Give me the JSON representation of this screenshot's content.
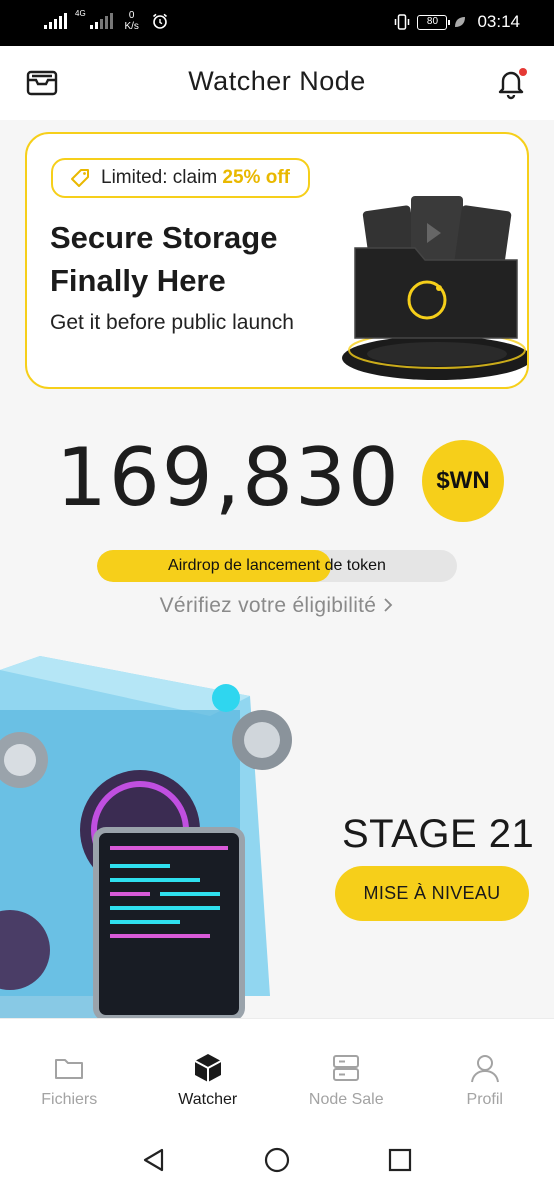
{
  "status_bar": {
    "network": "4G",
    "speed_value": "0",
    "speed_unit": "K/s",
    "battery": "80",
    "time": "03:14"
  },
  "header": {
    "title": "Watcher Node"
  },
  "promo": {
    "tag_prefix": "Limited: claim ",
    "tag_highlight": "25% off",
    "title": "Secure Storage Finally Here",
    "subtitle": "Get it before public launch"
  },
  "balance": {
    "amount": "169,830",
    "token": "$WN"
  },
  "airdrop": {
    "label": "Airdrop de lancement de token",
    "progress": 0.65,
    "verify_link": "Vérifiez votre éligibilité"
  },
  "stage": {
    "label": "STAGE 21",
    "upgrade_button": "MISE À NIVEAU"
  },
  "bottom_nav": {
    "items": [
      {
        "label": "Fichiers",
        "icon": "folder-icon",
        "active": false
      },
      {
        "label": "Watcher",
        "icon": "cube-icon",
        "active": true
      },
      {
        "label": "Node Sale",
        "icon": "server-icon",
        "active": false
      },
      {
        "label": "Profil",
        "icon": "user-icon",
        "active": false
      }
    ]
  },
  "colors": {
    "accent": "#f6cf1a",
    "text": "#1a1a1a",
    "muted": "#a3a3a3",
    "notification": "#e53935"
  }
}
